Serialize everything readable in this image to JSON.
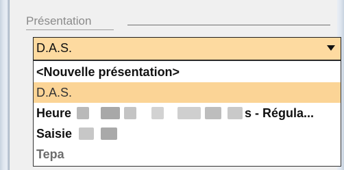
{
  "group": {
    "title": "Présentation"
  },
  "combo": {
    "value": "D.A.S."
  },
  "dropdown": {
    "options": [
      {
        "label": "<Nouvelle présentation>",
        "bold": true,
        "selected": false
      },
      {
        "label": "D.A.S.",
        "bold": false,
        "selected": true
      },
      {
        "label_start": "Heure",
        "label_end": "s - Régula...",
        "bold": true,
        "selected": false,
        "partially_obscured": true
      },
      {
        "label_start": "Saisie",
        "bold": true,
        "selected": false,
        "partially_obscured": true
      },
      {
        "label": "Tepa",
        "bold": true,
        "selected": false,
        "color": "grey"
      }
    ]
  },
  "colors": {
    "selection": "#fbd496",
    "combo_bg": "#fddaa0"
  }
}
